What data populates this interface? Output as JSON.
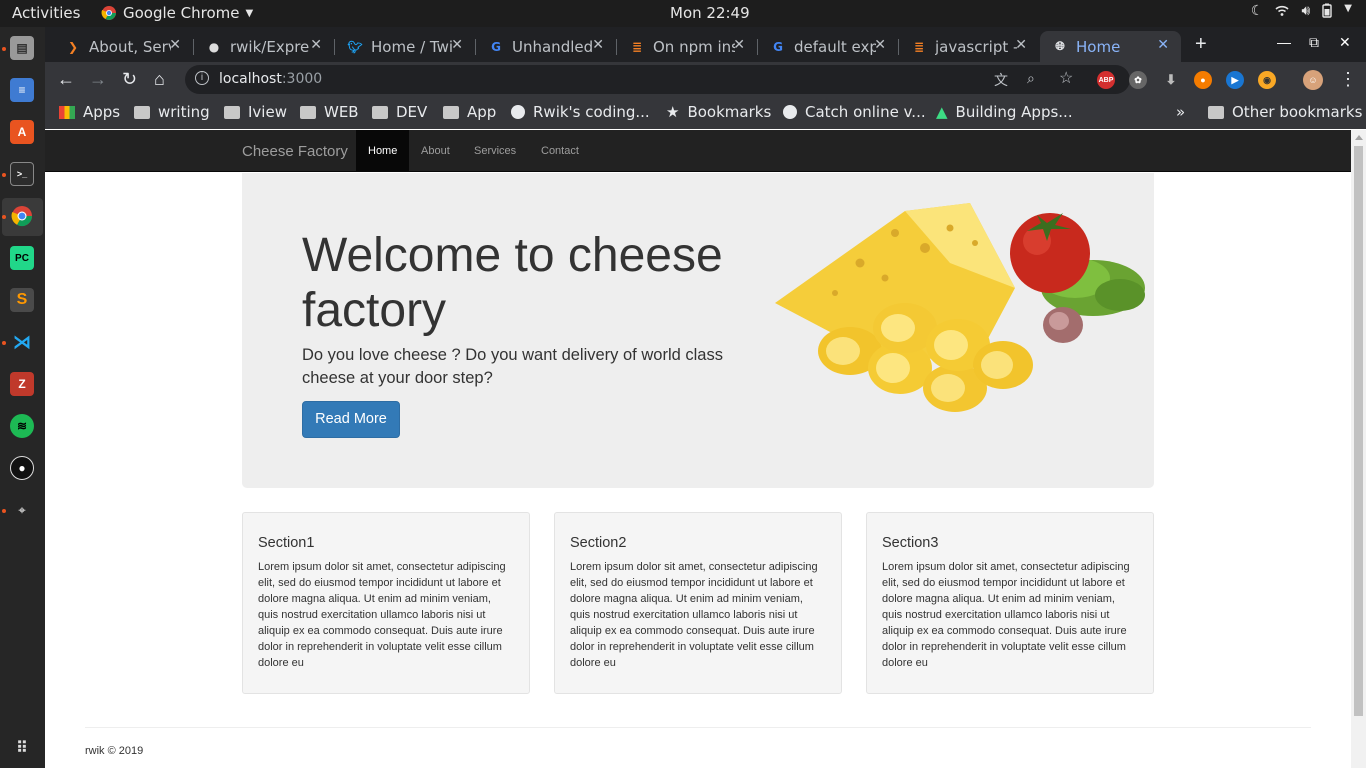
{
  "os": {
    "activities": "Activities",
    "app_name": "Google Chrome",
    "clock": "Mon 22:49"
  },
  "browser": {
    "tabs": [
      {
        "title": "About, Serv",
        "icon": "git-icon"
      },
      {
        "title": "rwik/Expre",
        "icon": "github-icon"
      },
      {
        "title": "Home / Twi",
        "icon": "twitter-icon"
      },
      {
        "title": "Unhandled",
        "icon": "google-icon"
      },
      {
        "title": "On npm ins",
        "icon": "stackoverflow-icon"
      },
      {
        "title": "default exp",
        "icon": "google-icon"
      },
      {
        "title": "javascript -",
        "icon": "stackoverflow-icon"
      },
      {
        "title": "Home",
        "icon": "globe-icon"
      }
    ],
    "url": "localhost",
    "url_port": ":3000",
    "bookmarks": [
      "Apps",
      "writing",
      "Iview",
      "WEB",
      "DEV",
      "App",
      "Rwik's coding...",
      "Bookmarks",
      "Catch online v...",
      "Building Apps..."
    ],
    "overflow": "»",
    "other_bookmarks": "Other bookmarks"
  },
  "site": {
    "brand": "Cheese Factory",
    "nav": [
      "Home",
      "About",
      "Services",
      "Contact"
    ],
    "hero": {
      "title": "Welcome to cheese factory",
      "text": "Do you love cheese ? Do you want delivery of world class cheese at your door step?",
      "button": "Read More"
    },
    "sections": [
      {
        "title": "Section1",
        "text": "Lorem ipsum dolor sit amet, consectetur adipiscing elit, sed do eiusmod tempor incididunt ut labore et dolore magna aliqua. Ut enim ad minim veniam, quis nostrud exercitation ullamco laboris nisi ut aliquip ex ea commodo consequat. Duis aute irure dolor in reprehenderit in voluptate velit esse cillum dolore eu"
      },
      {
        "title": "Section2",
        "text": "Lorem ipsum dolor sit amet, consectetur adipiscing elit, sed do eiusmod tempor incididunt ut labore et dolore magna aliqua. Ut enim ad minim veniam, quis nostrud exercitation ullamco laboris nisi ut aliquip ex ea commodo consequat. Duis aute irure dolor in reprehenderit in voluptate velit esse cillum dolore eu"
      },
      {
        "title": "Section3",
        "text": "Lorem ipsum dolor sit amet, consectetur adipiscing elit, sed do eiusmod tempor incididunt ut labore et dolore magna aliqua. Ut enim ad minim veniam, quis nostrud exercitation ullamco laboris nisi ut aliquip ex ea commodo consequat. Duis aute irure dolor in reprehenderit in voluptate velit esse cillum dolore eu"
      }
    ],
    "footer": "rwik © 2019"
  },
  "colors": {
    "navbar": "#222222",
    "jumbotron": "#eeeeee",
    "primary_button": "#337ab7",
    "chrome_dark": "#202124",
    "chrome_toolbar": "#35363a"
  }
}
